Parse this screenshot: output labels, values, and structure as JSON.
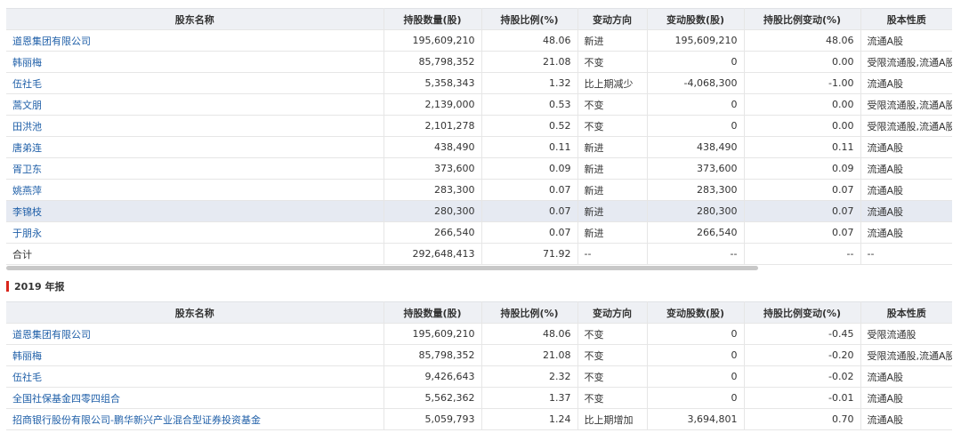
{
  "columns": [
    "股东名称",
    "持股数量(股)",
    "持股比例(%)",
    "变动方向",
    "变动股数(股)",
    "持股比例变动(%)",
    "股本性质"
  ],
  "table1": [
    {
      "name": "道恩集团有限公司",
      "shares": "195,609,210",
      "ratio": "48.06",
      "direction": "新进",
      "change": "195,609,210",
      "ratio_change": "48.06",
      "type": "流通A股"
    },
    {
      "name": "韩丽梅",
      "shares": "85,798,352",
      "ratio": "21.08",
      "direction": "不变",
      "change": "0",
      "ratio_change": "0.00",
      "type": "受限流通股,流通A股"
    },
    {
      "name": "伍社毛",
      "shares": "5,358,343",
      "ratio": "1.32",
      "direction": "比上期减少",
      "change": "-4,068,300",
      "ratio_change": "-1.00",
      "type": "流通A股"
    },
    {
      "name": "蒿文朋",
      "shares": "2,139,000",
      "ratio": "0.53",
      "direction": "不变",
      "change": "0",
      "ratio_change": "0.00",
      "type": "受限流通股,流通A股"
    },
    {
      "name": "田洪池",
      "shares": "2,101,278",
      "ratio": "0.52",
      "direction": "不变",
      "change": "0",
      "ratio_change": "0.00",
      "type": "受限流通股,流通A股"
    },
    {
      "name": "唐弟连",
      "shares": "438,490",
      "ratio": "0.11",
      "direction": "新进",
      "change": "438,490",
      "ratio_change": "0.11",
      "type": "流通A股"
    },
    {
      "name": "胥卫东",
      "shares": "373,600",
      "ratio": "0.09",
      "direction": "新进",
      "change": "373,600",
      "ratio_change": "0.09",
      "type": "流通A股"
    },
    {
      "name": "姚燕萍",
      "shares": "283,300",
      "ratio": "0.07",
      "direction": "新进",
      "change": "283,300",
      "ratio_change": "0.07",
      "type": "流通A股"
    },
    {
      "name": "李锦枝",
      "shares": "280,300",
      "ratio": "0.07",
      "direction": "新进",
      "change": "280,300",
      "ratio_change": "0.07",
      "type": "流通A股"
    },
    {
      "name": "于朋永",
      "shares": "266,540",
      "ratio": "0.07",
      "direction": "新进",
      "change": "266,540",
      "ratio_change": "0.07",
      "type": "流通A股"
    }
  ],
  "total": {
    "name": "合计",
    "shares": "292,648,413",
    "ratio": "71.92",
    "direction": "--",
    "change": "--",
    "ratio_change": "--",
    "type": "--"
  },
  "section2_title": "2019 年报",
  "table2": [
    {
      "name": "道恩集团有限公司",
      "shares": "195,609,210",
      "ratio": "48.06",
      "direction": "不变",
      "change": "0",
      "ratio_change": "-0.45",
      "type": "受限流通股"
    },
    {
      "name": "韩丽梅",
      "shares": "85,798,352",
      "ratio": "21.08",
      "direction": "不变",
      "change": "0",
      "ratio_change": "-0.20",
      "type": "受限流通股,流通A股"
    },
    {
      "name": "伍社毛",
      "shares": "9,426,643",
      "ratio": "2.32",
      "direction": "不变",
      "change": "0",
      "ratio_change": "-0.02",
      "type": "流通A股"
    },
    {
      "name": "全国社保基金四零四组合",
      "shares": "5,562,362",
      "ratio": "1.37",
      "direction": "不变",
      "change": "0",
      "ratio_change": "-0.01",
      "type": "流通A股"
    },
    {
      "name": "招商银行股份有限公司-鹏华新兴产业混合型证券投资基金",
      "shares": "5,059,793",
      "ratio": "1.24",
      "direction": "比上期增加",
      "change": "3,694,801",
      "ratio_change": "0.70",
      "type": "流通A股"
    }
  ]
}
